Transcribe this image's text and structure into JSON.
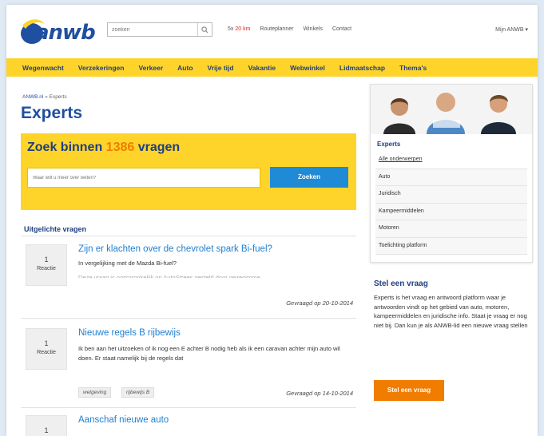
{
  "header": {
    "logo_text": "anwb",
    "search_placeholder": "zoeken",
    "links": [
      {
        "pre": "5x ",
        "highlight": "20 km",
        "post": ""
      },
      {
        "pre": "Routeplanner",
        "highlight": "",
        "post": ""
      },
      {
        "pre": "Winkels",
        "highlight": "",
        "post": ""
      },
      {
        "pre": "Contact",
        "highlight": "",
        "post": ""
      }
    ],
    "account": "Mijn ANWB ▾"
  },
  "nav": {
    "items": [
      "Wegenwacht",
      "Verzekeringen",
      "Verkeer",
      "Auto",
      "Vrije tijd",
      "Vakantie",
      "Webwinkel",
      "Lidmaatschap",
      "Thema's"
    ]
  },
  "breadcrumb": {
    "home": "ANWB.nl",
    "sep": " » ",
    "current": "Experts"
  },
  "page_title": "Experts",
  "search_panel": {
    "title_pre": "Zoek binnen ",
    "count": "1386",
    "title_post": " vragen",
    "input_placeholder": "Waar wilt u meer over weten?",
    "button": "Zoeken"
  },
  "featured": {
    "title": "Uitgelichte vragen",
    "questions": [
      {
        "count": "1",
        "count_label": "Reactie",
        "title": "Zijn er klachten over de chevrolet spark Bi-fuel?",
        "text": "In vergelijking met de Mazda Bi-fuel?",
        "faded": "Deze vraag is oorspronkelijk op AutoStrees gesteld door gezegimme",
        "date": "Gevraagd op 20-10-2014",
        "tags": []
      },
      {
        "count": "1",
        "count_label": "Reactie",
        "title": "Nieuwe regels B rijbewijs",
        "text": "Ik ben aan het uitzoeken of ik nog een E achter B nodig heb als ik een caravan achter mijn auto wil doen. Er staat namelijk bij de regels dat",
        "faded": "",
        "date": "Gevraagd op 14-10-2014",
        "tags": [
          "wetgeving",
          "rijbewijs B"
        ]
      },
      {
        "count": "1",
        "count_label": "",
        "title": "Aanschaf nieuwe auto",
        "text": "",
        "faded": "",
        "date": "",
        "tags": []
      }
    ]
  },
  "sidebar": {
    "experts_title": "Experts",
    "items": [
      "Alle onderwerpen",
      "Auto",
      "Juridisch",
      "Kampeermiddelen",
      "Motoren",
      "Toelichting platform"
    ],
    "ask_title": "Stel een vraag",
    "ask_text": "Experts is het vraag en antwoord platform waar je antwoorden vindt op het gebied van auto, motoren, kampeermiddelen en juridische info. Staat je vraag er nog niet bij. Dan kun je als ANWB-lid een nieuwe vraag stellen",
    "ask_button": "Stel een vraag"
  }
}
